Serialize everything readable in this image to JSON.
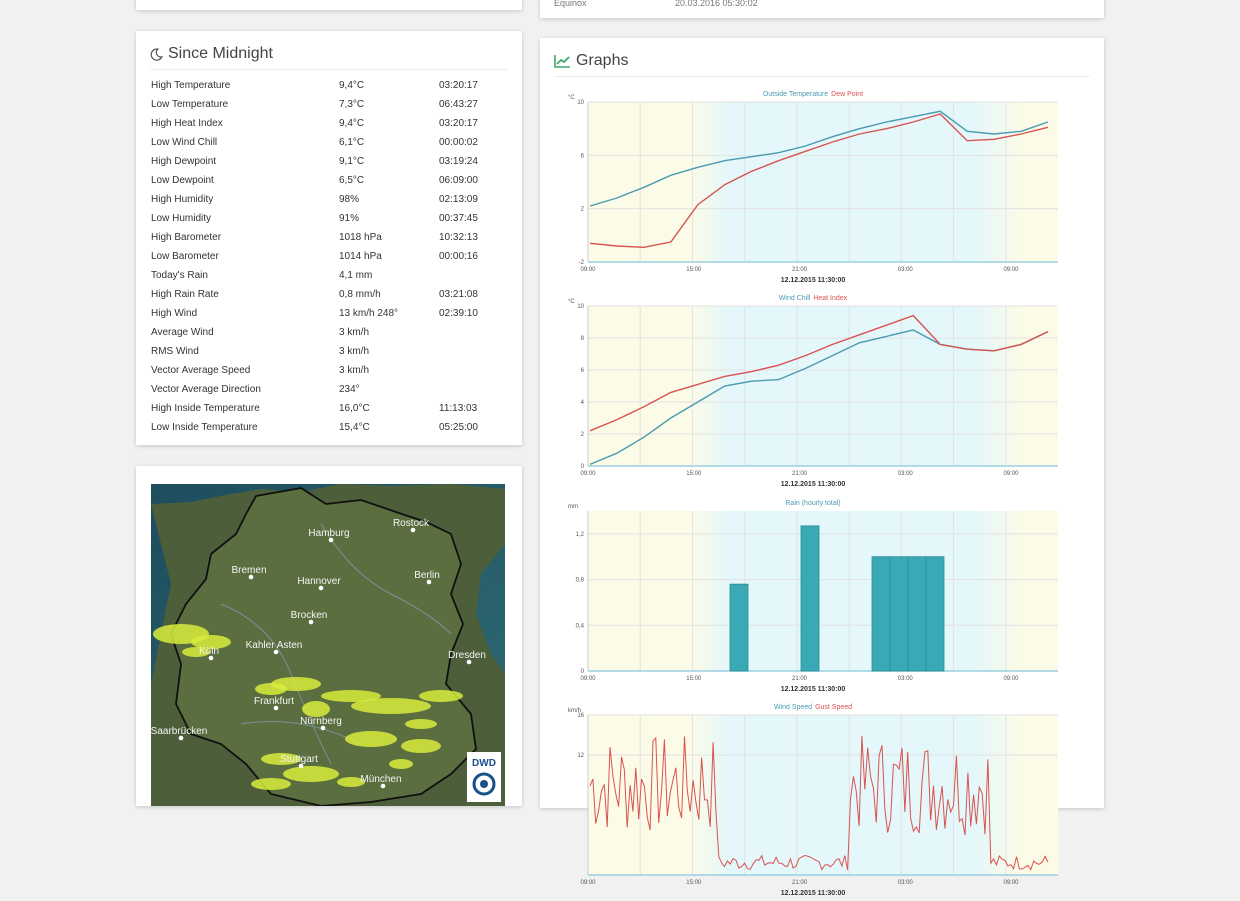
{
  "top_fragment": {
    "label": "Equinox",
    "value": "20.03.2016 05:30:02"
  },
  "since_midnight": {
    "title": "Since Midnight",
    "rows": [
      {
        "label": "High Temperature",
        "value": "9,4°C",
        "time": "03:20:17"
      },
      {
        "label": "Low Temperature",
        "value": "7,3°C",
        "time": "06:43:27"
      },
      {
        "label": "High Heat Index",
        "value": "9,4°C",
        "time": "03:20:17"
      },
      {
        "label": "Low Wind Chill",
        "value": "6,1°C",
        "time": "00:00:02"
      },
      {
        "label": "High Dewpoint",
        "value": "9,1°C",
        "time": "03:19:24"
      },
      {
        "label": "Low Dewpoint",
        "value": "6,5°C",
        "time": "06:09:00"
      },
      {
        "label": "High Humidity",
        "value": "98%",
        "time": "02:13:09"
      },
      {
        "label": "Low Humidity",
        "value": "91%",
        "time": "00:37:45"
      },
      {
        "label": "High Barometer",
        "value": "1018 hPa",
        "time": "10:32:13"
      },
      {
        "label": "Low Barometer",
        "value": "1014 hPa",
        "time": "00:00:16"
      },
      {
        "label": "Today's Rain",
        "value": "4,1 mm",
        "time": ""
      },
      {
        "label": "High Rain Rate",
        "value": "0,8 mm/h",
        "time": "03:21:08"
      },
      {
        "label": "High Wind",
        "value": "13 km/h 248°",
        "time": "02:39:10"
      },
      {
        "label": "Average Wind",
        "value": "3 km/h",
        "time": ""
      },
      {
        "label": "RMS Wind",
        "value": "3 km/h",
        "time": ""
      },
      {
        "label": "Vector Average Speed",
        "value": "3 km/h",
        "time": ""
      },
      {
        "label": "Vector Average Direction",
        "value": "234°",
        "time": ""
      },
      {
        "label": "High Inside Temperature",
        "value": "16,0°C",
        "time": "11:13:03"
      },
      {
        "label": "Low Inside Temperature",
        "value": "15,4°C",
        "time": "05:25:00"
      }
    ]
  },
  "radar_map": {
    "cities": [
      "Hamburg",
      "Rostock",
      "Bremen",
      "Hannover",
      "Berlin",
      "Brocken",
      "Kahler Asten",
      "Köln",
      "Dresden",
      "Frankfurt",
      "Nürnberg",
      "Saarbrücken",
      "Stuttgart",
      "München"
    ],
    "logo_text": "DWD"
  },
  "graphs": {
    "title": "Graphs",
    "x_tick_labels": [
      "09:00",
      "15:00",
      "21:00",
      "03:00",
      "09:00"
    ],
    "date_caption": "12.12.2015 11:30:00",
    "colors": {
      "blue": "#4a9ab0",
      "red": "#d9534f",
      "bar": "#39a9b5",
      "accent": "#3fa86b"
    }
  },
  "chart_data": [
    {
      "type": "line",
      "unit": "°C",
      "ylim": [
        -2,
        10
      ],
      "yticks": [
        -2,
        2,
        6,
        10
      ],
      "x": [
        "09:00",
        "10:30",
        "12:00",
        "13:30",
        "15:00",
        "16:30",
        "18:00",
        "19:30",
        "21:00",
        "22:30",
        "24:00",
        "01:30",
        "03:00",
        "04:30",
        "06:00",
        "07:30",
        "09:00",
        "10:30"
      ],
      "series": [
        {
          "name": "Outside Temperature",
          "color": "#4a9ab0",
          "values": [
            2.2,
            2.8,
            3.6,
            4.5,
            5.1,
            5.6,
            5.9,
            6.2,
            6.7,
            7.4,
            8.0,
            8.5,
            8.9,
            9.3,
            7.8,
            7.6,
            7.8,
            8.5
          ]
        },
        {
          "name": "Dew Point",
          "color": "#d9534f",
          "values": [
            -0.6,
            -0.8,
            -0.9,
            -0.5,
            2.3,
            3.8,
            4.8,
            5.6,
            6.3,
            7.0,
            7.6,
            8.0,
            8.5,
            9.1,
            7.1,
            7.2,
            7.6,
            8.1
          ]
        }
      ]
    },
    {
      "type": "line",
      "unit": "°C",
      "ylim": [
        0,
        10
      ],
      "yticks": [
        0,
        2,
        4,
        6,
        8,
        10
      ],
      "x": [
        "09:00",
        "10:30",
        "12:00",
        "13:30",
        "15:00",
        "16:30",
        "18:00",
        "19:30",
        "21:00",
        "22:30",
        "24:00",
        "01:30",
        "03:00",
        "04:30",
        "06:00",
        "07:30",
        "09:00",
        "10:30"
      ],
      "series": [
        {
          "name": "Wind Chill",
          "color": "#4a9ab0",
          "values": [
            0.1,
            0.8,
            1.8,
            3.0,
            4.0,
            5.0,
            5.3,
            5.4,
            6.1,
            6.9,
            7.7,
            8.1,
            8.5,
            7.6,
            7.3,
            7.2,
            7.6,
            8.4
          ]
        },
        {
          "name": "Heat Index",
          "color": "#d9534f",
          "values": [
            2.2,
            2.9,
            3.7,
            4.6,
            5.1,
            5.6,
            5.9,
            6.3,
            6.9,
            7.6,
            8.2,
            8.8,
            9.4,
            7.6,
            7.3,
            7.2,
            7.6,
            8.4
          ]
        }
      ]
    },
    {
      "type": "bar",
      "unit": "mm",
      "ylim": [
        0,
        1.4
      ],
      "yticks": [
        0.0,
        0.4,
        0.8,
        1.2
      ],
      "x": [
        "21:00",
        "23:00",
        "01:00",
        "02:00",
        "03:00",
        "04:00"
      ],
      "series": [
        {
          "name": "Rain (hourly total)",
          "color": "#39a9b5",
          "values": [
            0.76,
            1.27,
            1.0,
            1.0,
            1.0,
            1.0
          ]
        }
      ]
    },
    {
      "type": "line",
      "unit": "km/h",
      "ylim": [
        0,
        16
      ],
      "yticks": [
        12,
        16
      ],
      "series": [
        {
          "name": "Wind Speed",
          "color": "#4a9ab0"
        },
        {
          "name": "Gust Speed",
          "color": "#d9534f"
        }
      ]
    }
  ]
}
